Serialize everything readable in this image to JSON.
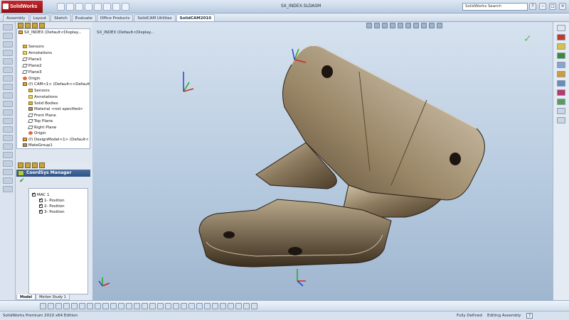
{
  "app": {
    "title": "SolidWorks",
    "document_title": "SX_INDEX.SLDASM",
    "search_placeholder": "SolidWorks Search"
  },
  "command_tabs": [
    {
      "label": "Assembly"
    },
    {
      "label": "Layout"
    },
    {
      "label": "Sketch"
    },
    {
      "label": "Evaluate"
    },
    {
      "label": "Office Products"
    },
    {
      "label": "SolidCAM Utilities"
    },
    {
      "label": "SolidCAM2010",
      "active": true
    }
  ],
  "feature_tree": {
    "root_label": "SX_INDEX  (Default<Display...",
    "items": [
      {
        "label": "Sensors",
        "icon": "folder-icon"
      },
      {
        "label": "Annotations",
        "icon": "annotation-icon"
      },
      {
        "label": "Plane1",
        "icon": "plane-icon"
      },
      {
        "label": "Plane2",
        "icon": "plane-icon"
      },
      {
        "label": "Plane3",
        "icon": "plane-icon"
      },
      {
        "label": "Origin",
        "icon": "origin-icon"
      },
      {
        "label": "(f) CAM<1> (Default<<Default",
        "icon": "part-icon"
      },
      {
        "label": "Sensors",
        "icon": "folder-icon"
      },
      {
        "label": "Annotations",
        "icon": "annotation-icon"
      },
      {
        "label": "Solid Bodies",
        "icon": "folder-icon"
      },
      {
        "label": "Material <not specified>",
        "icon": "material-icon"
      },
      {
        "label": "Front Plane",
        "icon": "plane-icon"
      },
      {
        "label": "Top Plane",
        "icon": "plane-icon"
      },
      {
        "label": "Right Plane",
        "icon": "plane-icon"
      },
      {
        "label": "Origin",
        "icon": "origin-icon"
      },
      {
        "label": "(f) DesignModel<1> (Default<",
        "icon": "part-icon"
      },
      {
        "label": "MateGroup1",
        "icon": "mate-icon"
      }
    ]
  },
  "coordsys_manager": {
    "title": "CoordSys Manager",
    "root": "MAC 1",
    "positions": [
      "1- Position",
      "2- Position",
      "3- Position"
    ]
  },
  "bottom_tabs": [
    {
      "label": "Model",
      "active": true
    },
    {
      "label": "Motion Study 1"
    }
  ],
  "triad_labels": {
    "x": "X",
    "y": "Y",
    "z": "Z"
  },
  "statusbar": {
    "left": "SolidWorks Premium 2010 x64 Edition",
    "definition": "Fully Defined",
    "mode": "Editing Assembly",
    "help": "?"
  },
  "colors": {
    "accent": "#2f5083",
    "part_dark": "#3c2f1f",
    "part_light": "#b8a98d",
    "x_axis": "#d22424",
    "y_axis": "#1faa1f",
    "z_axis": "#2a3fd6"
  }
}
